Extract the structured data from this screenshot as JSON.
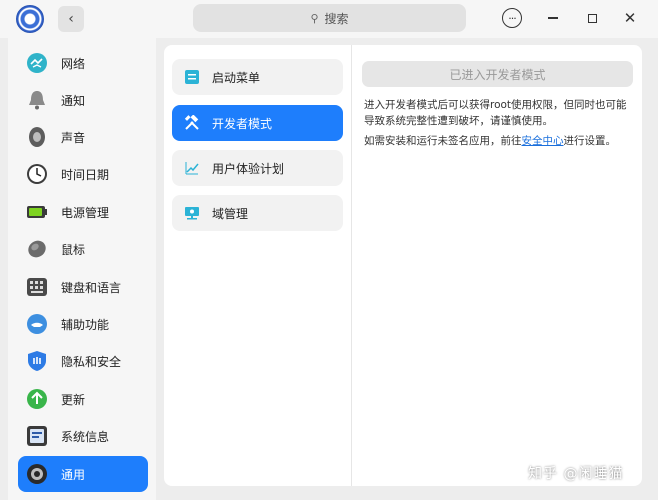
{
  "search": {
    "label": "搜索"
  },
  "sidebar": {
    "items": [
      {
        "label": "网络",
        "icon": "network-icon"
      },
      {
        "label": "通知",
        "icon": "bell-icon"
      },
      {
        "label": "声音",
        "icon": "speaker-icon"
      },
      {
        "label": "时间日期",
        "icon": "clock-icon"
      },
      {
        "label": "电源管理",
        "icon": "battery-icon"
      },
      {
        "label": "鼠标",
        "icon": "mouse-icon"
      },
      {
        "label": "键盘和语言",
        "icon": "keyboard-icon"
      },
      {
        "label": "辅助功能",
        "icon": "accessibility-icon"
      },
      {
        "label": "隐私和安全",
        "icon": "shield-icon"
      },
      {
        "label": "更新",
        "icon": "update-icon"
      },
      {
        "label": "系统信息",
        "icon": "system-info-icon"
      },
      {
        "label": "通用",
        "icon": "general-icon",
        "active": true
      }
    ]
  },
  "sub_menu": {
    "items": [
      {
        "label": "启动菜单",
        "icon": "boot-menu-icon"
      },
      {
        "label": "开发者模式",
        "icon": "tools-icon",
        "active": true
      },
      {
        "label": "用户体验计划",
        "icon": "chart-icon"
      },
      {
        "label": "域管理",
        "icon": "domain-icon"
      }
    ]
  },
  "developer": {
    "button_label": "已进入开发者模式",
    "description": "进入开发者模式后可以获得root使用权限，但同时也可能导致系统完整性遭到破坏，请谨慎使用。",
    "note_prefix": "如需安装和运行未签名应用，前往",
    "note_link": "安全中心",
    "note_suffix": "进行设置。"
  },
  "watermark": "知乎 @闲睡猫",
  "colors": {
    "accent": "#1e7efc",
    "link": "#1a6fdc"
  }
}
